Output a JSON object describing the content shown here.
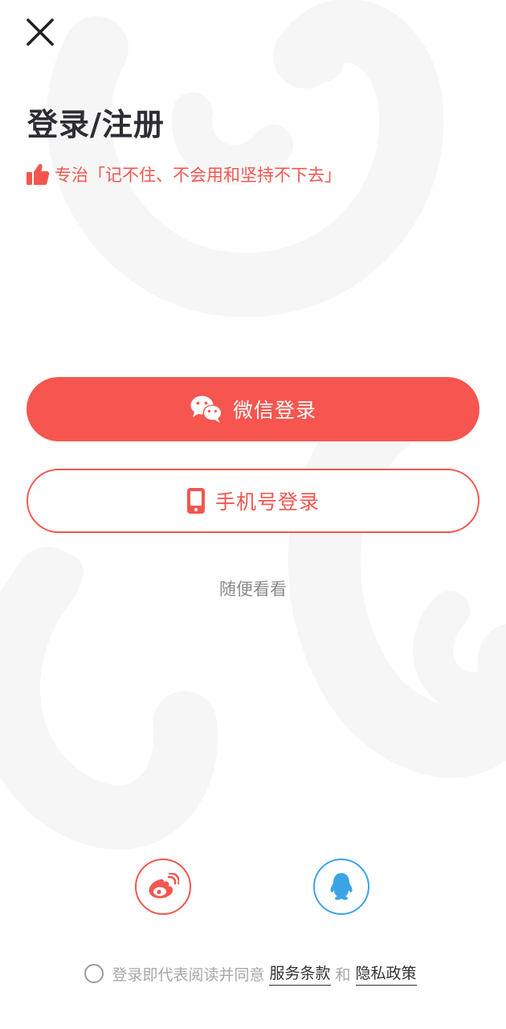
{
  "header": {
    "close_icon": "close-icon",
    "title": "登录/注册"
  },
  "slogan": {
    "icon": "thumbs-up-icon",
    "text": "专治「记不住、不会用和坚持不下去」"
  },
  "buttons": {
    "wechat_label": "微信登录",
    "wechat_icon": "wechat-icon",
    "phone_label": "手机号登录",
    "phone_icon": "phone-icon"
  },
  "browse_label": "随便看看",
  "social": {
    "weibo_icon": "weibo-icon",
    "qq_icon": "qq-icon"
  },
  "agreement": {
    "text": "登录即代表阅读并同意",
    "terms": "服务条款",
    "and": "和",
    "privacy": "隐私政策"
  },
  "colors": {
    "accent": "#f7554f",
    "qq_blue": "#3aa4e6",
    "title": "#2d2d33"
  }
}
